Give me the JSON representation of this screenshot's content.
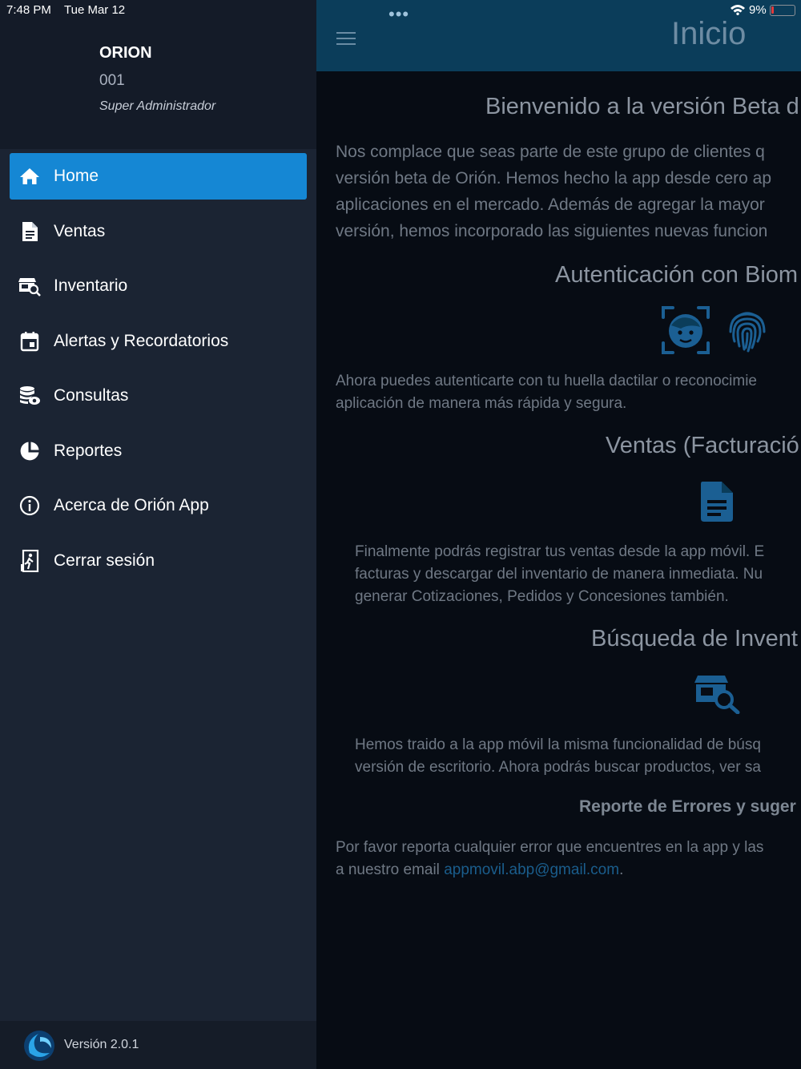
{
  "status_bar": {
    "time": "7:48 PM",
    "date": "Tue Mar 12",
    "dots": "•••",
    "battery": "9%"
  },
  "sidebar": {
    "company_name": "ORION",
    "company_code": "001",
    "user_role": "Super Administrador",
    "items": [
      {
        "label": "Home",
        "icon": "home-icon",
        "active": true
      },
      {
        "label": "Ventas",
        "icon": "document-icon"
      },
      {
        "label": "Inventario",
        "icon": "inventory-search-icon"
      },
      {
        "label": "Alertas y Recordatorios",
        "icon": "calendar-icon"
      },
      {
        "label": "Consultas",
        "icon": "database-eye-icon"
      },
      {
        "label": "Reportes",
        "icon": "pie-chart-icon"
      },
      {
        "label": "Acerca de Orión App",
        "icon": "info-icon"
      },
      {
        "label": "Cerrar sesión",
        "icon": "exit-door-icon"
      }
    ],
    "version": "Versión 2.0.1"
  },
  "header": {
    "title": "Inicio"
  },
  "content": {
    "welcome_title": "Bienvenido a la versión Beta d",
    "intro_lines": [
      "Nos complace que seas parte de este grupo de clientes q",
      "versión beta de Orión. Hemos hecho la app desde cero ap",
      "aplicaciones en el mercado. Además de agregar la mayor",
      "versión, hemos incorporado las siguientes nuevas funcion"
    ],
    "bio_title": "Autenticación con Biom",
    "bio_lines": [
      "Ahora puedes autenticarte con tu huella dactilar o reconocimie",
      "aplicación de manera más rápida y segura."
    ],
    "ventas_title": "Ventas (Facturació",
    "ventas_lines": [
      "Finalmente podrás registrar tus ventas desde la app móvil. E",
      "facturas y descargar del inventario de manera inmediata. Nu",
      "generar Cotizaciones, Pedidos y Concesiones también."
    ],
    "busqueda_title": "Búsqueda de Invent",
    "busqueda_lines": [
      "Hemos traido a la app móvil la misma funcionalidad de búsq",
      "versión de escritorio. Ahora podrás buscar productos, ver sa"
    ],
    "reporte_title": "Reporte de Errores y suger",
    "reporte_line1": "Por favor reporta cualquier error que encuentres en la app y las",
    "reporte_line2_prefix": "a nuestro email ",
    "email": "appmovil.abp@gmail.com",
    "reporte_line2_suffix": "."
  },
  "colors": {
    "accent": "#1587d4",
    "sidebar_bg": "#1b2433",
    "topbar_bg": "#0b3d5a",
    "icon_blue": "#1b5f93"
  }
}
